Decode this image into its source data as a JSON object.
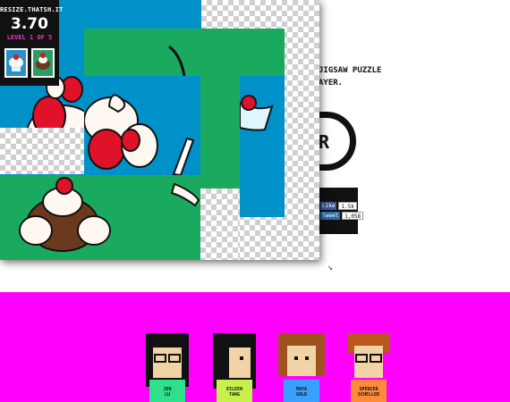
{
  "hud": {
    "site": "RESIZE.THATSH.IT",
    "score": "3.70",
    "level": "LEVEL 1 OF 5",
    "thumbnails": [
      "sundae-thumbnail",
      "sundae-thumbnail"
    ]
  },
  "page": {
    "intro_line1": "JIGSAW PUZZLE",
    "intro_line2": "AYER.",
    "start_glyph": "R",
    "social": {
      "like_label": "Like",
      "like_count": "1.5k",
      "tweet_label": "Tweet",
      "tweet_count": "1,058"
    }
  },
  "team": [
    {
      "name_line1": "JEN",
      "name_line2": "LU"
    },
    {
      "name_line1": "EILEEN",
      "name_line2": "TANG"
    },
    {
      "name_line1": "MAYA",
      "name_line2": "GOLD"
    },
    {
      "name_line1": "SPENCER",
      "name_line2": "SCHELLER"
    }
  ],
  "colors": {
    "accent": "#ff00ff",
    "hud_level": "#ff2bd6",
    "puzzle_blue": "#0091c8",
    "puzzle_green": "#1aaa5f",
    "cream": "#fff8f0",
    "cherry": "#e0122a"
  }
}
